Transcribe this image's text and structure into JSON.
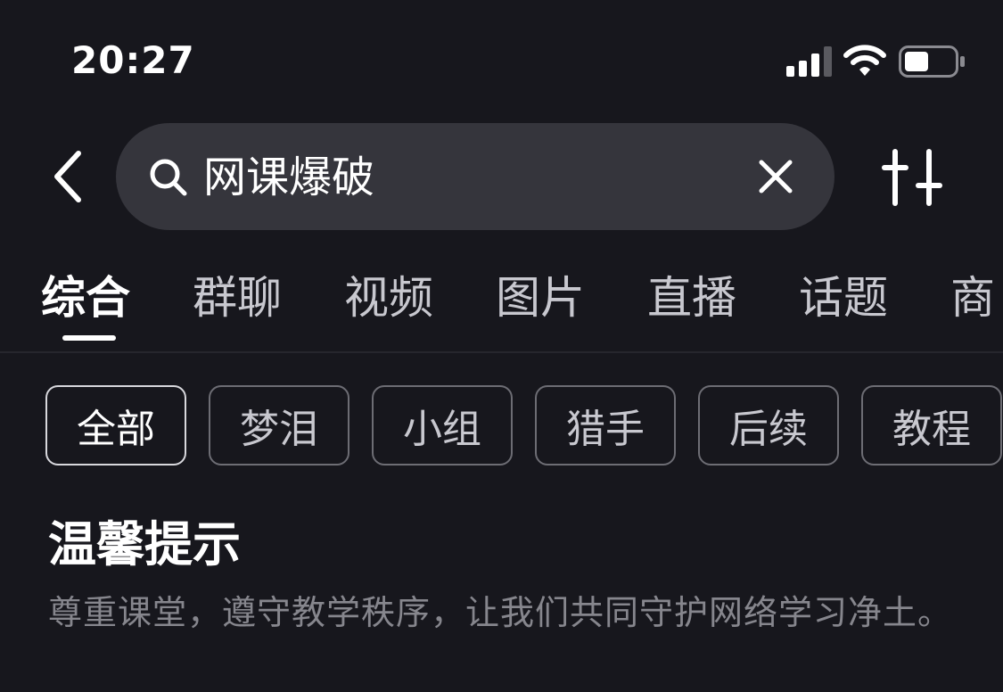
{
  "status_bar": {
    "time": "20:27",
    "icons": [
      "signal-icon",
      "wifi-icon",
      "battery-icon"
    ]
  },
  "search": {
    "query": "网课爆破",
    "icons": [
      "back-icon",
      "search-icon",
      "close-icon",
      "filter-icon"
    ]
  },
  "tabs": [
    {
      "label": "综合",
      "active": true
    },
    {
      "label": "群聊",
      "active": false
    },
    {
      "label": "视频",
      "active": false
    },
    {
      "label": "图片",
      "active": false
    },
    {
      "label": "直播",
      "active": false
    },
    {
      "label": "话题",
      "active": false
    },
    {
      "label": "商",
      "active": false
    }
  ],
  "chips": [
    {
      "label": "全部",
      "active": true
    },
    {
      "label": "梦泪",
      "active": false
    },
    {
      "label": "小组",
      "active": false
    },
    {
      "label": "猎手",
      "active": false
    },
    {
      "label": "后续",
      "active": false
    },
    {
      "label": "教程",
      "active": false
    }
  ],
  "notice": {
    "title": "温馨提示",
    "body": "尊重课堂，遵守教学秩序，让我们共同守护网络学习净土。"
  },
  "colors": {
    "background": "#17171d",
    "search_box": "#35353c",
    "text_primary": "#ffffff",
    "text_secondary": "#c8c8cf",
    "text_muted": "#86868d",
    "chip_border": "#6d6d74"
  }
}
